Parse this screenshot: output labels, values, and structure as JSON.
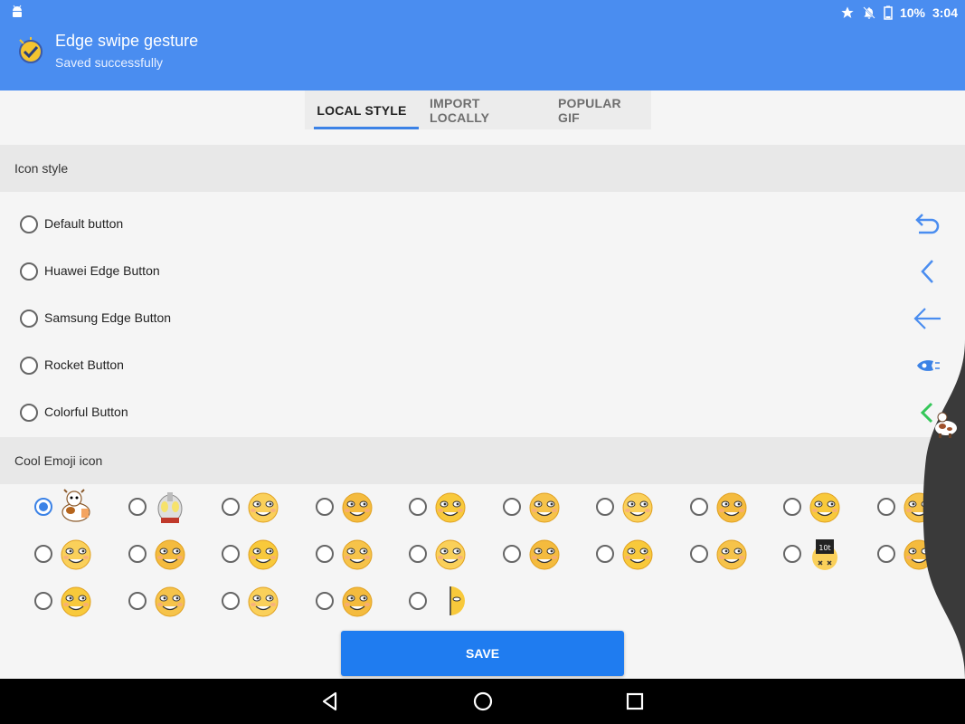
{
  "status_bar": {
    "battery": "10%",
    "time": "3:04",
    "icons": [
      "android-icon",
      "star-icon",
      "notifications-off-icon",
      "battery-icon"
    ]
  },
  "header": {
    "title": "Edge swipe gesture",
    "subtitle": "Saved successfully",
    "color": "#4a8df0"
  },
  "tabs": [
    {
      "label": "LOCAL STYLE",
      "active": true
    },
    {
      "label": "IMPORT LOCALLY",
      "active": false
    },
    {
      "label": "POPULAR GIF",
      "active": false
    }
  ],
  "icon_style": {
    "title": "Icon style",
    "options": [
      {
        "label": "Default button",
        "icon": "undo-arrow-icon",
        "selected": false
      },
      {
        "label": "Huawei Edge Button",
        "icon": "chevron-left-icon",
        "selected": false
      },
      {
        "label": "Samsung Edge Button",
        "icon": "arrow-left-icon",
        "selected": false
      },
      {
        "label": "Rocket Button",
        "icon": "rocket-icon",
        "selected": false
      },
      {
        "label": "Colorful Button",
        "icon": "colorful-chevron-icon",
        "selected": false
      }
    ]
  },
  "cool_emoji": {
    "title": "Cool Emoji icon",
    "selected_index": 0,
    "items": [
      "cow-emoji",
      "ultraman-emoji",
      "goggles-emoji",
      "doge-emoji",
      "shocked-cat-emoji",
      "smirk-emoji",
      "grin-emoji",
      "sunglasses-emoji",
      "laugh-cry-emoji",
      "black-eye-emoji",
      "bandage-emoji",
      "big-grin-emoji",
      "side-eye-emoji",
      "skeptical-emoji",
      "dizzy-emoji",
      "tongue-emoji",
      "puke-rainbow-emoji",
      "watermelon-emoji",
      "weight-emoji",
      "crying-emoji",
      "fish-emoji",
      "cold-sick-emoji",
      "spit-emoji",
      "slap-emoji",
      "half-face-emoji"
    ]
  },
  "save_button": {
    "label": "SAVE",
    "color": "#1f7cf0"
  },
  "nav_bar": {
    "buttons": [
      "back-icon",
      "home-icon",
      "recents-icon"
    ]
  },
  "accent_color": "#3b82e6"
}
